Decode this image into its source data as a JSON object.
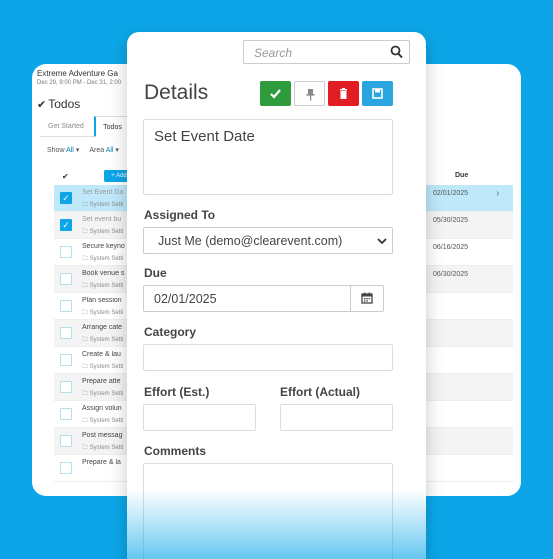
{
  "event": {
    "title": "Extreme Adventure Ga",
    "date_range": "Dec 29, 9:00 PM - Dec 31, 2:00"
  },
  "todos_panel": {
    "heading": "Todos",
    "tabs": [
      {
        "label": "Get Started",
        "active": false
      },
      {
        "label": "Todos",
        "active": true
      }
    ],
    "filters": {
      "show_label": "Show",
      "show_value": "All",
      "area_label": "Area",
      "area_value": "All"
    },
    "add_label": "+ Add",
    "column_todo": "To",
    "column_due": "Due",
    "rows": [
      {
        "name": "Set Event Da",
        "category": "System Setti",
        "due": "02/01/2025",
        "checked": true,
        "selected": true
      },
      {
        "name": "Set event bu",
        "category": "System Setti",
        "due": "05/30/2025",
        "checked": true,
        "selected": false
      },
      {
        "name": "Secure keyno",
        "category": "System Setti",
        "due": "06/16/2025",
        "checked": false,
        "selected": false
      },
      {
        "name": "Book venue s",
        "category": "System Setti",
        "due": "06/30/2025",
        "checked": false,
        "selected": false
      },
      {
        "name": "Plan session",
        "category": "System Setti",
        "due": "",
        "checked": false,
        "selected": false
      },
      {
        "name": "Arrange cate",
        "category": "System Setti",
        "due": "",
        "checked": false,
        "selected": false
      },
      {
        "name": "Create & lau",
        "category": "System Setti",
        "due": "",
        "checked": false,
        "selected": false
      },
      {
        "name": "Prepare atte",
        "category": "System Setti",
        "due": "",
        "checked": false,
        "selected": false
      },
      {
        "name": "Assign volun",
        "category": "System Setti",
        "due": "",
        "checked": false,
        "selected": false
      },
      {
        "name": "Post messag",
        "category": "System Setti",
        "due": "",
        "checked": false,
        "selected": false
      },
      {
        "name": "Prepare & la",
        "category": "",
        "due": "",
        "checked": false,
        "selected": false
      }
    ]
  },
  "details": {
    "search_placeholder": "Search",
    "title": "Details",
    "actions": {
      "complete_icon": "check-icon",
      "pin_icon": "pin-icon",
      "delete_icon": "trash-icon",
      "save_icon": "save-icon"
    },
    "todo_title": "Set Event Date",
    "assigned_to_label": "Assigned To",
    "assigned_to_value": "Just Me (demo@clearevent.com)",
    "due_label": "Due",
    "due_value": "02/01/2025",
    "category_label": "Category",
    "category_value": "",
    "effort_est_label": "Effort (Est.)",
    "effort_est_value": "",
    "effort_actual_label": "Effort (Actual)",
    "effort_actual_value": "",
    "comments_label": "Comments",
    "comments_value": ""
  },
  "colors": {
    "background": "#0ca6e8",
    "complete": "#2e9b3c",
    "delete": "#e01e23",
    "save": "#29a6e0",
    "selected_row": "#bfe9fb"
  }
}
